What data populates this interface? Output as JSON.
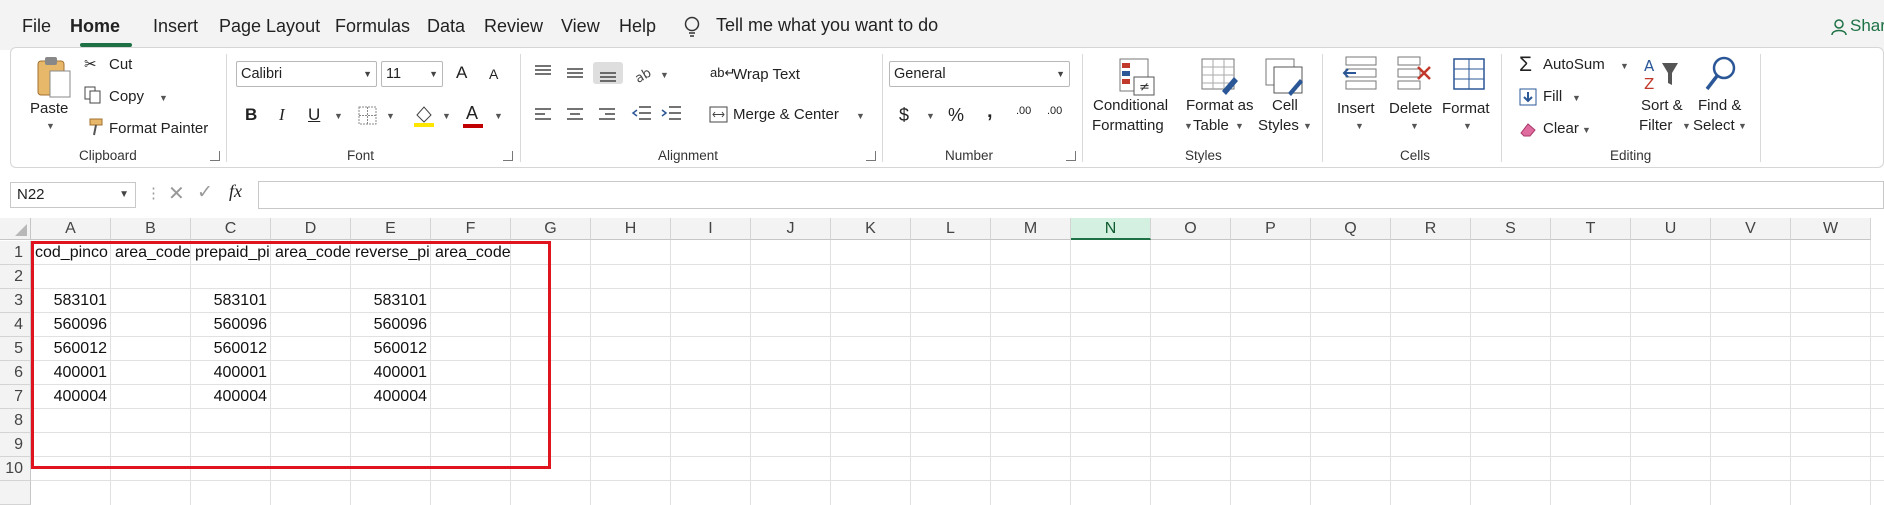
{
  "menu": {
    "items": [
      "File",
      "Home",
      "Insert",
      "Page Layout",
      "Formulas",
      "Data",
      "Review",
      "View",
      "Help"
    ],
    "tell_me": "Tell me what you want to do",
    "share": "Shar"
  },
  "ribbon": {
    "clipboard": {
      "paste": "Paste",
      "cut": "Cut",
      "copy": "Copy",
      "format_painter": "Format Painter",
      "label": "Clipboard"
    },
    "font": {
      "name": "Calibri",
      "size": "11",
      "bold": "B",
      "italic": "I",
      "underline": "U",
      "font_color": "A",
      "grow": "A",
      "shrink": "A",
      "label": "Font"
    },
    "alignment": {
      "wrap": "Wrap Text",
      "merge": "Merge & Center",
      "label": "Alignment"
    },
    "number": {
      "format": "General",
      "currency": "$",
      "percent": "%",
      "comma": "‚",
      "inc_decimal": ".00",
      "dec_decimal": ".00",
      "label": "Number"
    },
    "styles": {
      "conditional_1": "Conditional",
      "conditional_2": "Formatting",
      "table_1": "Format as",
      "table_2": "Table",
      "cell_1": "Cell",
      "cell_2": "Styles",
      "label": "Styles"
    },
    "cells": {
      "insert": "Insert",
      "delete": "Delete",
      "format": "Format",
      "label": "Cells"
    },
    "editing": {
      "autosum": "AutoSum",
      "fill": "Fill",
      "clear": "Clear",
      "sort_1": "Sort &",
      "sort_2": "Filter",
      "find_1": "Find &",
      "find_2": "Select",
      "label": "Editing"
    },
    "colors": {
      "accent": "#1e7145",
      "highlight_fill": "#ffe600",
      "font_red": "#c00000"
    }
  },
  "formula_bar": {
    "name_box": "N22",
    "fx": "fx",
    "value": ""
  },
  "grid": {
    "columns": [
      "A",
      "B",
      "C",
      "D",
      "E",
      "F",
      "G",
      "H",
      "I",
      "J",
      "K",
      "L",
      "M",
      "N",
      "O",
      "P",
      "Q",
      "R",
      "S",
      "T",
      "U",
      "V",
      "W"
    ],
    "selected_column": "N",
    "rows": [
      "1",
      "2",
      "3",
      "4",
      "5",
      "6",
      "7",
      "8",
      "9",
      "10"
    ],
    "headers": {
      "A": "cod_pinco",
      "B": "area_code",
      "C": "prepaid_pi",
      "D": "area_code",
      "E": "reverse_pi",
      "F": "area_codes"
    },
    "values": {
      "A": [
        "583101",
        "560096",
        "560012",
        "400001",
        "400004"
      ],
      "C": [
        "583101",
        "560096",
        "560012",
        "400001",
        "400004"
      ],
      "E": [
        "583101",
        "560096",
        "560012",
        "400001",
        "400004"
      ]
    },
    "highlight_color": "#e0141e"
  }
}
